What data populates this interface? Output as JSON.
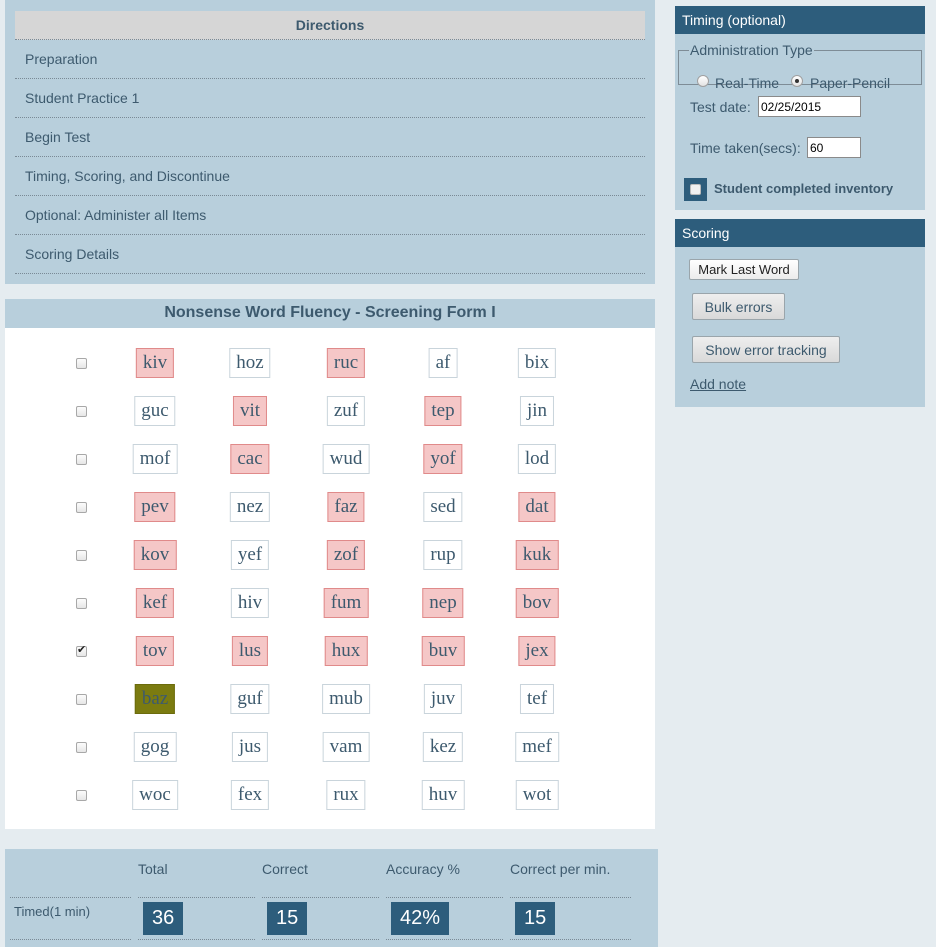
{
  "directions": {
    "header": "Directions",
    "items": [
      "Preparation",
      "Student Practice 1",
      "Begin Test",
      "Timing, Scoring, and Discontinue",
      "Optional: Administer all Items",
      "Scoring Details"
    ]
  },
  "word_panel": {
    "title": "Nonsense Word Fluency - Screening Form I",
    "rows": [
      {
        "checked": false,
        "words": [
          {
            "text": "kiv",
            "state": "error"
          },
          {
            "text": "hoz",
            "state": "normal"
          },
          {
            "text": "ruc",
            "state": "error"
          },
          {
            "text": "af",
            "state": "normal"
          },
          {
            "text": "bix",
            "state": "normal"
          }
        ]
      },
      {
        "checked": false,
        "words": [
          {
            "text": "guc",
            "state": "normal"
          },
          {
            "text": "vit",
            "state": "error"
          },
          {
            "text": "zuf",
            "state": "normal"
          },
          {
            "text": "tep",
            "state": "error"
          },
          {
            "text": "jin",
            "state": "normal"
          }
        ]
      },
      {
        "checked": false,
        "words": [
          {
            "text": "mof",
            "state": "normal"
          },
          {
            "text": "cac",
            "state": "error"
          },
          {
            "text": "wud",
            "state": "normal"
          },
          {
            "text": "yof",
            "state": "error"
          },
          {
            "text": "lod",
            "state": "normal"
          }
        ]
      },
      {
        "checked": false,
        "words": [
          {
            "text": "pev",
            "state": "error"
          },
          {
            "text": "nez",
            "state": "normal"
          },
          {
            "text": "faz",
            "state": "error"
          },
          {
            "text": "sed",
            "state": "normal"
          },
          {
            "text": "dat",
            "state": "error"
          }
        ]
      },
      {
        "checked": false,
        "words": [
          {
            "text": "kov",
            "state": "error"
          },
          {
            "text": "yef",
            "state": "normal"
          },
          {
            "text": "zof",
            "state": "error"
          },
          {
            "text": "rup",
            "state": "normal"
          },
          {
            "text": "kuk",
            "state": "error"
          }
        ]
      },
      {
        "checked": false,
        "words": [
          {
            "text": "kef",
            "state": "error"
          },
          {
            "text": "hiv",
            "state": "normal"
          },
          {
            "text": "fum",
            "state": "error"
          },
          {
            "text": "nep",
            "state": "error"
          },
          {
            "text": "bov",
            "state": "error"
          }
        ]
      },
      {
        "checked": true,
        "words": [
          {
            "text": "tov",
            "state": "error"
          },
          {
            "text": "lus",
            "state": "error"
          },
          {
            "text": "hux",
            "state": "error"
          },
          {
            "text": "buv",
            "state": "error"
          },
          {
            "text": "jex",
            "state": "error"
          }
        ]
      },
      {
        "checked": false,
        "words": [
          {
            "text": "baz",
            "state": "last"
          },
          {
            "text": "guf",
            "state": "normal"
          },
          {
            "text": "mub",
            "state": "normal"
          },
          {
            "text": "juv",
            "state": "normal"
          },
          {
            "text": "tef",
            "state": "normal"
          }
        ]
      },
      {
        "checked": false,
        "words": [
          {
            "text": "gog",
            "state": "normal"
          },
          {
            "text": "jus",
            "state": "normal"
          },
          {
            "text": "vam",
            "state": "normal"
          },
          {
            "text": "kez",
            "state": "normal"
          },
          {
            "text": "mef",
            "state": "normal"
          }
        ]
      },
      {
        "checked": false,
        "words": [
          {
            "text": "woc",
            "state": "normal"
          },
          {
            "text": "fex",
            "state": "normal"
          },
          {
            "text": "rux",
            "state": "normal"
          },
          {
            "text": "huv",
            "state": "normal"
          },
          {
            "text": "wot",
            "state": "normal"
          }
        ]
      }
    ]
  },
  "summary": {
    "headers": [
      "Total",
      "Correct",
      "Accuracy %",
      "Correct per min."
    ],
    "row_label": "Timed(1 min)",
    "values": [
      "36",
      "15",
      "42%",
      "15"
    ]
  },
  "timing": {
    "title": "Timing (optional)",
    "admin_type_legend": "Administration Type",
    "radio_realtime": "Real-Time",
    "radio_paperpencil": "Paper-Pencil",
    "selected": "Paper-Pencil",
    "test_date_label": "Test date:",
    "test_date_value": "02/25/2015",
    "time_taken_label": "Time taken(secs):",
    "time_taken_value": "60",
    "completed_label": "Student completed inventory",
    "completed_checked": false
  },
  "scoring": {
    "title": "Scoring",
    "mark_last_word": "Mark Last Word",
    "bulk_errors": "Bulk errors",
    "show_error_tracking": "Show error tracking",
    "add_note": "Add note"
  },
  "colors": {
    "panel_bg": "#b8cfdc",
    "header_dark": "#2d5d7c",
    "error_bg": "#f5c7c7",
    "last_word_bg": "#7b7b10",
    "page_bg": "#e5ecf0"
  }
}
